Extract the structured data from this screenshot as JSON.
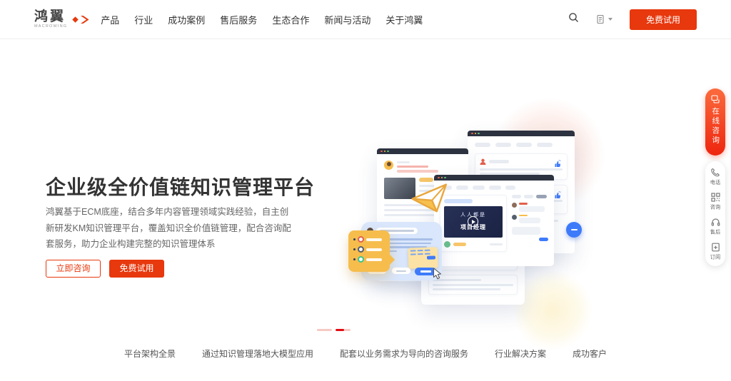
{
  "brand": {
    "name": "鸿翼",
    "subname": "MACROWING"
  },
  "nav": {
    "items": [
      "产品",
      "行业",
      "成功案例",
      "售后服务",
      "生态合作",
      "新闻与活动",
      "关于鸿翼"
    ],
    "trial_button": "免费试用"
  },
  "hero": {
    "title": "企业级全价值链知识管理平台",
    "description": "鸿翼基于ECM底座，结合多年内容管理领域实践经验，自主创新研发KM知识管理平台，覆盖知识全价值链管理，配合咨询配套服务，助力企业构建完整的知识管理体系",
    "consult_button": "立即咨询",
    "trial_button": "免费试用"
  },
  "illustration": {
    "video_title_line1": "人人都是",
    "video_title_line2": "项目经理"
  },
  "floating_bar": {
    "online_consult": "在线咨询",
    "items": [
      {
        "label": "电话",
        "icon": "phone-icon"
      },
      {
        "label": "咨询",
        "icon": "qr-code-icon"
      },
      {
        "label": "售后",
        "icon": "headset-icon"
      },
      {
        "label": "订阅",
        "icon": "subscribe-icon"
      }
    ]
  },
  "footer": {
    "links": [
      "平台架构全景",
      "通过知识管理落地大模型应用",
      "配套以业务需求为导向的咨询服务",
      "行业解决方案",
      "成功客户"
    ]
  },
  "colors": {
    "accent": "#e8380d",
    "blue": "#3e7bfa",
    "yellow": "#f6bd4d"
  }
}
